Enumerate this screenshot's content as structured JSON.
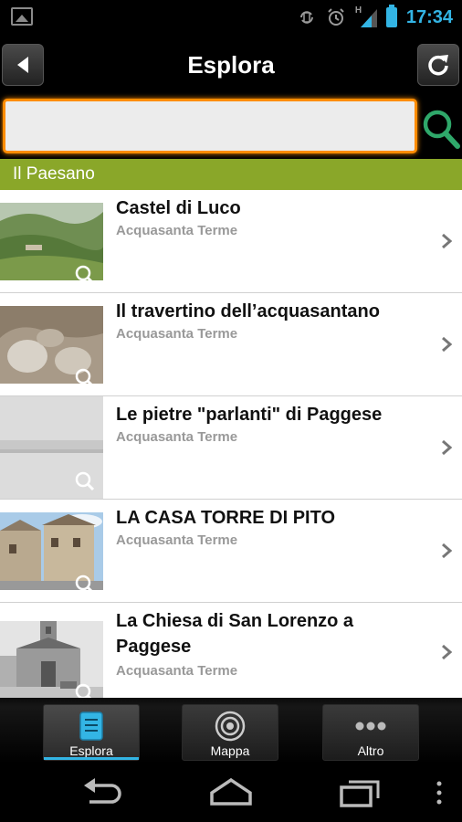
{
  "status_bar": {
    "time": "17:34",
    "network_label": "H"
  },
  "header": {
    "title": "Esplora"
  },
  "search": {
    "value": "",
    "placeholder": ""
  },
  "section": {
    "title": "Il Paesano"
  },
  "items": [
    {
      "title": "Castel di Luco",
      "subtitle": "Acquasanta Terme"
    },
    {
      "title": "Il travertino dell’acquasantano",
      "subtitle": "Acquasanta Terme"
    },
    {
      "title": "Le pietre \"parlanti\" di Paggese",
      "subtitle": "Acquasanta Terme"
    },
    {
      "title": "LA CASA TORRE DI PITO",
      "subtitle": "Acquasanta Terme"
    },
    {
      "title": "La Chiesa di San Lorenzo a Paggese",
      "subtitle": "Acquasanta Terme"
    }
  ],
  "tabs": [
    {
      "label": "Esplora",
      "icon": "list-icon",
      "active": true
    },
    {
      "label": "Mappa",
      "icon": "target-icon",
      "active": false
    },
    {
      "label": "Altro",
      "icon": "more-icon",
      "active": false
    }
  ],
  "colors": {
    "accent_blue": "#33b5e5",
    "search_border": "#ff8c00",
    "section_green": "#8aa729",
    "search_icon_green": "#2fa86a"
  }
}
